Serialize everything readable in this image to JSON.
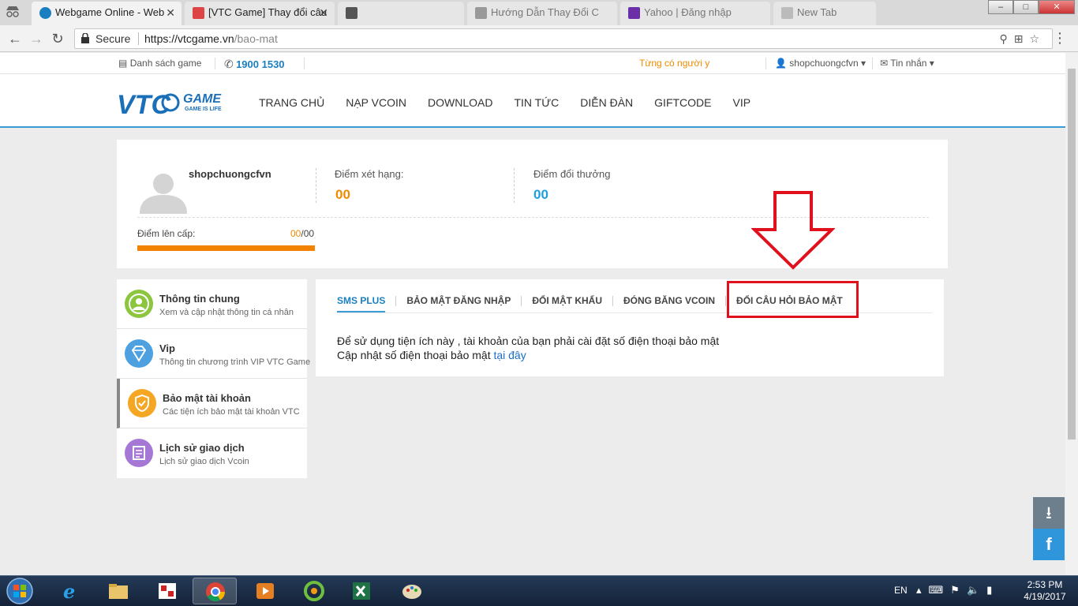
{
  "browser": {
    "tabs": [
      {
        "title": "Webgame Online - Web",
        "active": true
      },
      {
        "title": "[VTC Game] Thay đổi câu",
        "active": false
      },
      {
        "title": "",
        "active": false
      },
      {
        "title": "Hướng Dẫn Thay Đổi C",
        "active": false
      },
      {
        "title": "Yahoo | Đăng nhập",
        "active": false
      },
      {
        "title": "New Tab",
        "active": false
      }
    ],
    "close_glyph": "✕",
    "secure_label": "Secure",
    "url_host": "https://vtcgame.vn",
    "url_path": "/bao-mat",
    "window_controls": {
      "minimize": "–",
      "maximize": "□",
      "close": "✕"
    }
  },
  "topstrip": {
    "games_list": "Danh sách game",
    "phone": "1900 1530",
    "marquee": "Từng có người y",
    "username": "shopchuongcfvn",
    "messages": "Tin nhắn"
  },
  "nav": {
    "items": [
      "TRANG CHỦ",
      "NẠP VCOIN",
      "DOWNLOAD",
      "TIN TỨC",
      "DIỄN ĐÀN",
      "GIFTCODE",
      "VIP"
    ]
  },
  "logo": {
    "main": "VTC",
    "game": "GAME",
    "tagline": "GAME IS LIFE"
  },
  "profile": {
    "username": "shopchuongcfvn",
    "rank_points_label": "Điểm xét hạng:",
    "rank_points_value": "00",
    "reward_points_label": "Điểm đổi thưởng",
    "reward_points_value": "00",
    "level_label": "Điểm lên cấp:",
    "level_current": "00",
    "level_total": "/00",
    "level_progress": 1.0
  },
  "sidebar": {
    "items": [
      {
        "title": "Thông tin chung",
        "desc": "Xem và cập nhật thông tin cá nhân",
        "icon": "user-icon",
        "color": "#8cc63f"
      },
      {
        "title": "Vip",
        "desc": "Thông tin chương trình VIP VTC Game",
        "icon": "diamond-icon",
        "color": "#4ea1e0"
      },
      {
        "title": "Bảo mật tài khoản",
        "desc": "Các tiện ích bảo mật tài khoản VTC",
        "icon": "shield-icon",
        "color": "#f5a623"
      },
      {
        "title": "Lịch sử giao dịch",
        "desc": "Lịch sử giao dịch Vcoin",
        "icon": "history-icon",
        "color": "#a678d6"
      }
    ]
  },
  "security_tabs": [
    "SMS PLUS",
    "BẢO MẬT ĐĂNG NHẬP",
    "ĐỔI MẬT KHẨU",
    "ĐÓNG BĂNG VCOIN",
    "ĐỔI CÂU HỎI BẢO MẬT"
  ],
  "content": {
    "line1": "Để sử dụng tiện ích này , tài khoản của bạn phải cài đặt số điện thoại bảo mật",
    "line2": "Cập nhật số điện thoại bảo mật",
    "link": "tại đây"
  },
  "float_buttons": {
    "download": "⭳",
    "facebook": "f"
  },
  "taskbar": {
    "lang": "EN",
    "time": "2:53 PM",
    "date": "4/19/2017"
  },
  "colors": {
    "accent": "#3a9bd5",
    "orange": "#f38200",
    "red_annotation": "#e1101d"
  }
}
